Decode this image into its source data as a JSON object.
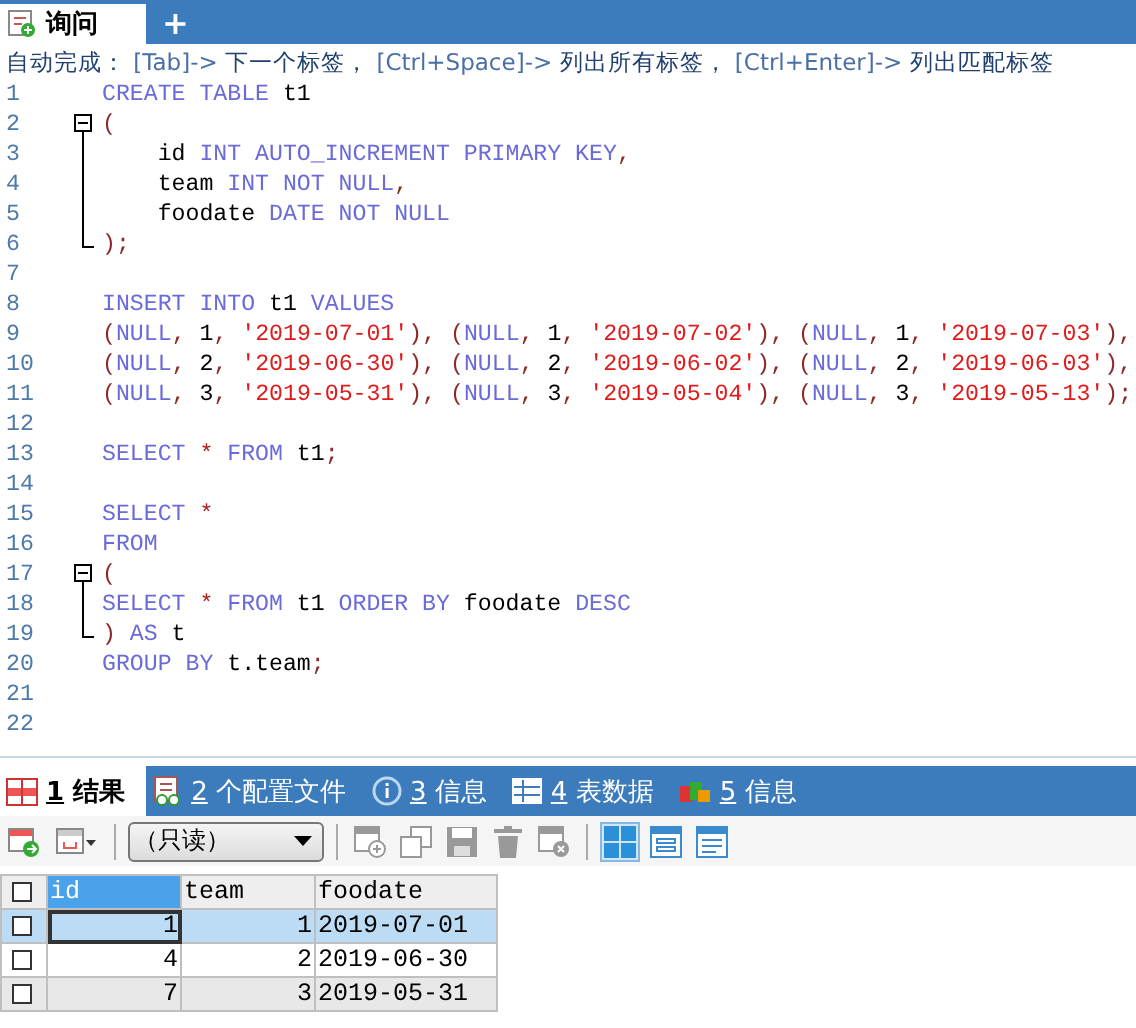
{
  "editor_tabs": [
    {
      "label": "询问",
      "selected": true
    }
  ],
  "new_tab": {
    "label": "+"
  },
  "hint": [
    {
      "kind": "label",
      "text": "自动完成："
    },
    {
      "kind": "key",
      "text": " [Tab]-> "
    },
    {
      "kind": "label",
      "text": "下一个标签，"
    },
    {
      "kind": "key",
      "text": " [Ctrl+Space]-> "
    },
    {
      "kind": "label",
      "text": "列出所有标签，"
    },
    {
      "kind": "key",
      "text": " [Ctrl+Enter]-> "
    },
    {
      "kind": "label",
      "text": "列出匹配标签"
    }
  ],
  "code_lines": [
    {
      "number": "1",
      "tokens": [
        {
          "kind": "kw",
          "text": "CREATE TABLE "
        },
        {
          "kind": "id",
          "text": "t1"
        }
      ]
    },
    {
      "number": "2",
      "fold_toggle": true,
      "tokens": [
        {
          "kind": "p",
          "text": "("
        }
      ]
    },
    {
      "number": "3",
      "fold_line": true,
      "tokens": [
        {
          "kind": "id",
          "text": "    id "
        },
        {
          "kind": "kw",
          "text": "INT AUTO_INCREMENT PRIMARY KEY"
        },
        {
          "kind": "p",
          "text": ","
        }
      ]
    },
    {
      "number": "4",
      "fold_line": true,
      "tokens": [
        {
          "kind": "id",
          "text": "    team "
        },
        {
          "kind": "kw",
          "text": "INT NOT NULL"
        },
        {
          "kind": "p",
          "text": ","
        }
      ]
    },
    {
      "number": "5",
      "fold_line": true,
      "tokens": [
        {
          "kind": "id",
          "text": "    foodate "
        },
        {
          "kind": "kw",
          "text": "DATE NOT NULL"
        }
      ]
    },
    {
      "number": "6",
      "fold_end": true,
      "tokens": [
        {
          "kind": "p",
          "text": ");"
        }
      ]
    },
    {
      "number": "7"
    },
    {
      "number": "8",
      "tokens": [
        {
          "kind": "kw",
          "text": "INSERT INTO "
        },
        {
          "kind": "id",
          "text": "t1 "
        },
        {
          "kind": "kw",
          "text": "VALUES"
        }
      ]
    },
    {
      "number": "9",
      "tokens": [
        {
          "kind": "p",
          "text": "("
        },
        {
          "kind": "kw",
          "text": "NULL"
        },
        {
          "kind": "p",
          "text": ", "
        },
        {
          "kind": "id",
          "text": "1"
        },
        {
          "kind": "p",
          "text": ", "
        },
        {
          "kind": "str",
          "text": "'2019-07-01'"
        },
        {
          "kind": "p",
          "text": "), ("
        },
        {
          "kind": "kw",
          "text": "NULL"
        },
        {
          "kind": "p",
          "text": ", "
        },
        {
          "kind": "id",
          "text": "1"
        },
        {
          "kind": "p",
          "text": ", "
        },
        {
          "kind": "str",
          "text": "'2019-07-02'"
        },
        {
          "kind": "p",
          "text": "), ("
        },
        {
          "kind": "kw",
          "text": "NULL"
        },
        {
          "kind": "p",
          "text": ", "
        },
        {
          "kind": "id",
          "text": "1"
        },
        {
          "kind": "p",
          "text": ", "
        },
        {
          "kind": "str",
          "text": "'2019-07-03'"
        },
        {
          "kind": "p",
          "text": "),"
        }
      ]
    },
    {
      "number": "10",
      "tokens": [
        {
          "kind": "p",
          "text": "("
        },
        {
          "kind": "kw",
          "text": "NULL"
        },
        {
          "kind": "p",
          "text": ", "
        },
        {
          "kind": "id",
          "text": "2"
        },
        {
          "kind": "p",
          "text": ", "
        },
        {
          "kind": "str",
          "text": "'2019-06-30'"
        },
        {
          "kind": "p",
          "text": "), ("
        },
        {
          "kind": "kw",
          "text": "NULL"
        },
        {
          "kind": "p",
          "text": ", "
        },
        {
          "kind": "id",
          "text": "2"
        },
        {
          "kind": "p",
          "text": ", "
        },
        {
          "kind": "str",
          "text": "'2019-06-02'"
        },
        {
          "kind": "p",
          "text": "), ("
        },
        {
          "kind": "kw",
          "text": "NULL"
        },
        {
          "kind": "p",
          "text": ", "
        },
        {
          "kind": "id",
          "text": "2"
        },
        {
          "kind": "p",
          "text": ", "
        },
        {
          "kind": "str",
          "text": "'2019-06-03'"
        },
        {
          "kind": "p",
          "text": "),"
        }
      ]
    },
    {
      "number": "11",
      "tokens": [
        {
          "kind": "p",
          "text": "("
        },
        {
          "kind": "kw",
          "text": "NULL"
        },
        {
          "kind": "p",
          "text": ", "
        },
        {
          "kind": "id",
          "text": "3"
        },
        {
          "kind": "p",
          "text": ", "
        },
        {
          "kind": "str",
          "text": "'2019-05-31'"
        },
        {
          "kind": "p",
          "text": "), ("
        },
        {
          "kind": "kw",
          "text": "NULL"
        },
        {
          "kind": "p",
          "text": ", "
        },
        {
          "kind": "id",
          "text": "3"
        },
        {
          "kind": "p",
          "text": ", "
        },
        {
          "kind": "str",
          "text": "'2019-05-04'"
        },
        {
          "kind": "p",
          "text": "), ("
        },
        {
          "kind": "kw",
          "text": "NULL"
        },
        {
          "kind": "p",
          "text": ", "
        },
        {
          "kind": "id",
          "text": "3"
        },
        {
          "kind": "p",
          "text": ", "
        },
        {
          "kind": "str",
          "text": "'2019-05-13'"
        },
        {
          "kind": "p",
          "text": ");"
        }
      ]
    },
    {
      "number": "12"
    },
    {
      "number": "13",
      "tokens": [
        {
          "kind": "kw",
          "text": "SELECT "
        },
        {
          "kind": "op",
          "text": "* "
        },
        {
          "kind": "kw",
          "text": "FROM "
        },
        {
          "kind": "id",
          "text": "t1"
        },
        {
          "kind": "p",
          "text": ";"
        }
      ]
    },
    {
      "number": "14"
    },
    {
      "number": "15",
      "tokens": [
        {
          "kind": "kw",
          "text": "SELECT "
        },
        {
          "kind": "op",
          "text": "*"
        }
      ]
    },
    {
      "number": "16",
      "tokens": [
        {
          "kind": "kw",
          "text": "FROM"
        }
      ]
    },
    {
      "number": "17",
      "fold_toggle": true,
      "tokens": [
        {
          "kind": "p",
          "text": "("
        }
      ]
    },
    {
      "number": "18",
      "fold_line": true,
      "tokens": [
        {
          "kind": "kw",
          "text": "SELECT "
        },
        {
          "kind": "op",
          "text": "* "
        },
        {
          "kind": "kw",
          "text": "FROM "
        },
        {
          "kind": "id",
          "text": "t1 "
        },
        {
          "kind": "kw",
          "text": "ORDER BY "
        },
        {
          "kind": "id",
          "text": "foodate "
        },
        {
          "kind": "kw",
          "text": "DESC"
        }
      ]
    },
    {
      "number": "19",
      "fold_end": true,
      "tokens": [
        {
          "kind": "p",
          "text": ") "
        },
        {
          "kind": "kw",
          "text": "AS "
        },
        {
          "kind": "id",
          "text": "t"
        }
      ]
    },
    {
      "number": "20",
      "tokens": [
        {
          "kind": "kw",
          "text": "GROUP BY "
        },
        {
          "kind": "id",
          "text": "t.team"
        },
        {
          "kind": "p",
          "text": ";"
        }
      ]
    },
    {
      "number": "21"
    },
    {
      "number": "22"
    }
  ],
  "result_tabs": [
    {
      "kind": "result",
      "number": "1",
      "label": "结果",
      "selected": true
    },
    {
      "kind": "profile",
      "number": "2",
      "label": "个配置文件",
      "selected": false
    },
    {
      "kind": "info",
      "number": "3",
      "label": "信息",
      "selected": false
    },
    {
      "kind": "table",
      "number": "4",
      "label": "表数据",
      "selected": false
    },
    {
      "kind": "blocks",
      "number": "5",
      "label": "信息",
      "selected": false
    }
  ],
  "toolbar": {
    "left_tools": [
      {
        "kind": "add-row"
      },
      {
        "kind": "row-menu"
      }
    ],
    "mode_dropdown": {
      "value": "（只读）"
    },
    "edit_tools": [
      {
        "kind": "insert",
        "disabled": true
      },
      {
        "kind": "copy",
        "disabled": true
      },
      {
        "kind": "save",
        "disabled": true
      },
      {
        "kind": "delete",
        "disabled": true
      },
      {
        "kind": "cancel",
        "disabled": true
      }
    ],
    "view_tools": [
      {
        "kind": "grid",
        "selected": true
      },
      {
        "kind": "form",
        "selected": false
      },
      {
        "kind": "text",
        "selected": false
      }
    ]
  },
  "grid": {
    "header_checked": false,
    "columns": [
      {
        "name": "id",
        "kind": "number",
        "selected": true
      },
      {
        "name": "team",
        "kind": "number",
        "selected": false
      },
      {
        "name": "foodate",
        "kind": "text",
        "selected": false
      }
    ],
    "rows": [
      {
        "checked": false,
        "selected": true,
        "focused": true,
        "cells": [
          "1",
          "1",
          "2019-07-01"
        ]
      },
      {
        "checked": false,
        "selected": false,
        "focused": false,
        "cells": [
          "4",
          "2",
          "2019-06-30"
        ]
      },
      {
        "checked": false,
        "selected": false,
        "focused": false,
        "cells": [
          "7",
          "3",
          "2019-05-31"
        ]
      }
    ]
  }
}
